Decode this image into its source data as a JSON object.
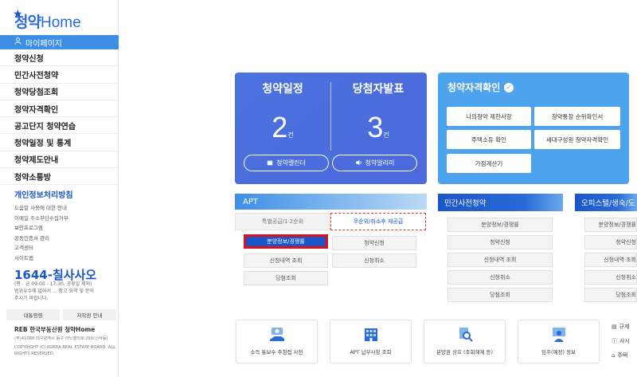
{
  "logo": {
    "ko": "청약",
    "en": "Home"
  },
  "sidebar": {
    "mypage_label": "마이페이지",
    "items": [
      {
        "label": "청약신청"
      },
      {
        "label": "민간사전청약"
      },
      {
        "label": "청약당첨조회"
      },
      {
        "label": "청약자격확인"
      },
      {
        "label": "공고단지 청약연습"
      },
      {
        "label": "청약일정 및 통계"
      },
      {
        "label": "청약제도안내"
      },
      {
        "label": "청약소통방"
      }
    ],
    "sub_title": "개인정보처리방침",
    "sub_links": [
      "도움말 사용에 대한 안내",
      "이메일 주소무단수집거부",
      "보안프로그램",
      "공동인증서 관리",
      "고객센터",
      "사이트맵"
    ],
    "phone": "1644-칠사사오",
    "phone_info": "(평 - 금 09:00 - 17:30, 공휴일 제외)\n범위우수에 없어서 ... 참고 요약 및 문의\n주시기 바랍니다.",
    "foot_buttons": [
      "대통령령",
      "저작권 안내"
    ],
    "reb_name": "REB 한국부동산원 청약Home",
    "reb_address": "(주)41068 대구광역시 동구 이노밸리로 291(신서동)",
    "reb_copyright": "COPYRIGHT (C) KOREA REAL ESTATE BOARD. ALL RIGHTS RESERVED."
  },
  "schedule_card": {
    "left_title": "청약일정",
    "left_count": "2",
    "right_title": "당첨자발표",
    "right_count": "3",
    "unit": "건",
    "left_button": "청약캘린더",
    "right_button": "청약알리미"
  },
  "qual_card": {
    "title": "청약자격확인",
    "buttons": [
      "나의청약 제한사항",
      "청약통장 순위확인서",
      "주택소유 확인",
      "세대구성원 청약자격확인",
      "가점계산기"
    ]
  },
  "apt": {
    "header": "APT",
    "tabs": [
      "특별공급/1·2순위",
      "무순위/취소후 재공급"
    ],
    "buttons": [
      "분양정보/경쟁률",
      "청약신청",
      "신청내역 조회",
      "신청취소",
      "당첨조회"
    ]
  },
  "private_panel": {
    "header": "민간사전청약",
    "buttons": [
      "분양정보/경쟁률",
      "청약신청",
      "신청내역 조회",
      "신청취소",
      "당첨조회"
    ]
  },
  "officetel_panel": {
    "header": "오피스텔/생숙/도",
    "buttons": [
      "분양정보/경쟁률",
      "청약신청",
      "신청내역 조회",
      "신청취소",
      "당첨조회"
    ]
  },
  "bottom_icons": [
    {
      "label": "소득 통보수 추첨접 사전",
      "icon": "money-hand-icon"
    },
    {
      "label": "APT 납부사항 조회",
      "icon": "building-icon"
    },
    {
      "label": "분양권 상호 (조회해제 등)",
      "icon": "search-doc-icon"
    },
    {
      "label": "임주(예정) 정보",
      "icon": "person-board-icon"
    }
  ],
  "right_list": [
    "규제",
    "사시",
    "주택"
  ]
}
